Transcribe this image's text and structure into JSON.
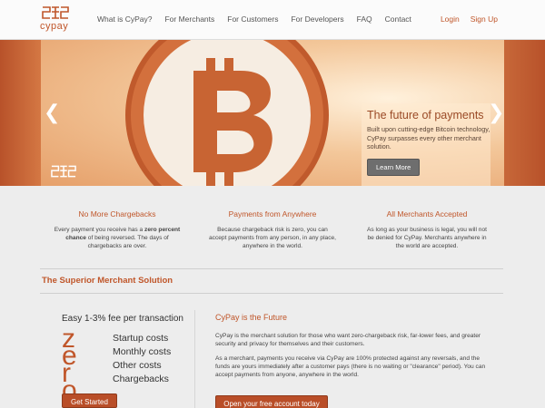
{
  "brand": {
    "name": "cypay"
  },
  "nav": {
    "items": [
      "What is CyPay?",
      "For Merchants",
      "For Customers",
      "For Developers",
      "FAQ",
      "Contact"
    ],
    "login": "Login",
    "signup": "Sign Up"
  },
  "hero": {
    "prev_arrow": "❮",
    "next_arrow": "❯",
    "title": "The future of payments",
    "text": "Built upon cutting-edge Bitcoin technology, CyPay surpasses every other merchant solution.",
    "button": "Learn More"
  },
  "features": [
    {
      "title": "No More Chargebacks",
      "pre": "Every payment you receive has a ",
      "bold": "zero percent chance",
      "post": " of being reversed. The days of chargebacks are over."
    },
    {
      "title": "Payments from Anywhere",
      "text": "Because chargeback risk is zero, you can accept payments from any person, in any place, anywhere in the world."
    },
    {
      "title": "All Merchants Accepted",
      "text": "As long as your business is legal, you will not be denied for CyPay. Merchants anywhere in the world are accepted."
    }
  ],
  "section_title": "The Superior Merchant Solution",
  "promo": {
    "fee": "Easy 1-3% fee per transaction",
    "zero_letters": [
      "z",
      "e",
      "r",
      "o"
    ],
    "costs": [
      "Startup costs",
      "Monthly costs",
      "Other costs",
      "Chargebacks"
    ],
    "button": "Get Started"
  },
  "future": {
    "title": "CyPay is the Future",
    "p1": "CyPay is the merchant solution for those who want zero-chargeback risk, far-lower fees, and greater security and privacy for themselves and their customers.",
    "p2": "As a merchant, payments you receive via CyPay are 100% protected against any reversals, and the funds are yours immediately after a customer pays (there is no waiting or \"clearance\" period). You can accept payments from anyone, anywhere in the world.",
    "button": "Open your free account today"
  },
  "colors": {
    "accent": "#c0562a",
    "button": "#b94e28",
    "hero_edge": "#b8522a"
  }
}
